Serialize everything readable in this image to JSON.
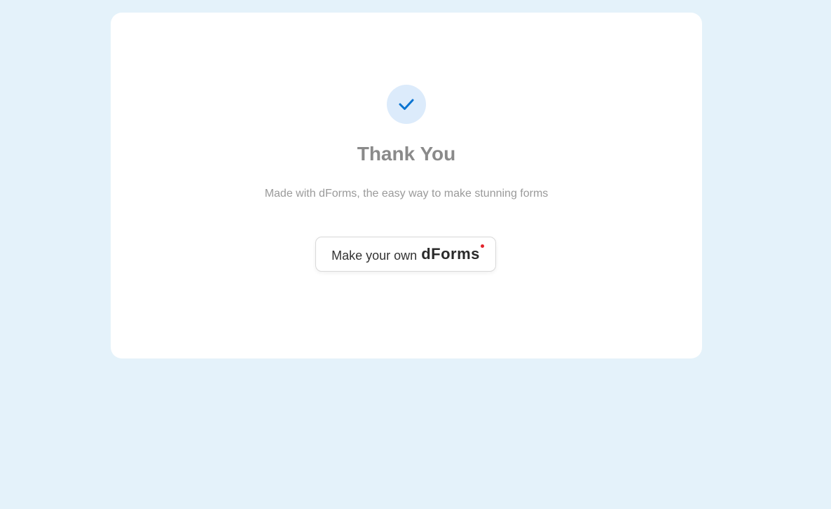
{
  "page": {
    "title": "Thank You",
    "subtitle": "Made with dForms, the easy way to make stunning forms",
    "icon": "checkmark-icon"
  },
  "cta": {
    "prefix": "Make your own",
    "brand": "dForms"
  },
  "colors": {
    "background": "#e4f2fa",
    "card": "#ffffff",
    "check_bg": "#dcebfb",
    "check": "#0a74d1",
    "brand_dot": "#e3242b"
  }
}
